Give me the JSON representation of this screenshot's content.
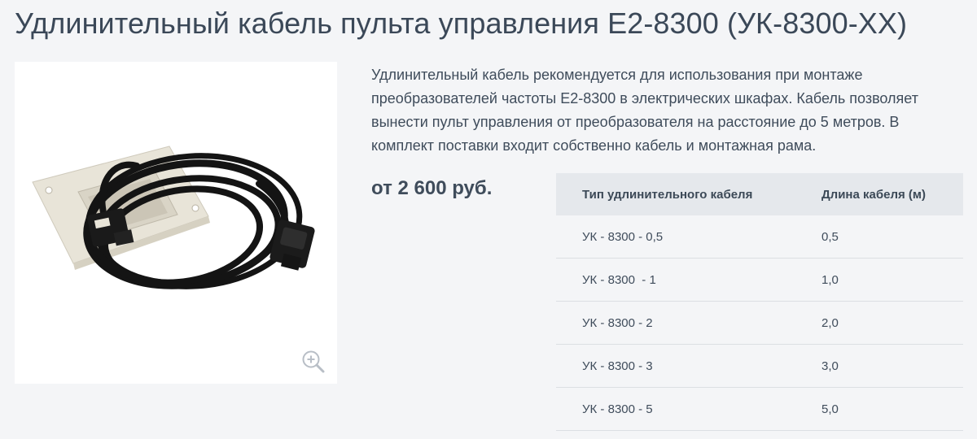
{
  "page": {
    "title": "Удлинительный кабель пульта управления Е2-8300 (УК-8300-ХХ)"
  },
  "product": {
    "image_alt": "Удлинительный кабель УК-8300 с монтажной рамой",
    "zoom_icon": "zoom-in-icon",
    "description": "Удлинительный кабель рекомендуется для использования при монтаже преобразователей частоты Е2-8300 в электрических шкафах. Кабель позволяет вынести пульт управления от преобразователя на расстояние до 5 метров. В комплект поставки входит собственно кабель и монтажная рама.",
    "price": "от 2 600 руб."
  },
  "table": {
    "headers": [
      "Тип удлинительного кабеля",
      "Длина кабеля (м)"
    ],
    "rows": [
      [
        "УК - 8300 - 0,5",
        "0,5"
      ],
      [
        "УК - 8300  - 1",
        "1,0"
      ],
      [
        "УК - 8300 - 2",
        "2,0"
      ],
      [
        "УК - 8300 - 3",
        "3,0"
      ],
      [
        "УК - 8300 - 5",
        "5,0"
      ]
    ]
  },
  "colors": {
    "background": "#f4f5f7",
    "text": "#3f4c5b",
    "table_header_bg": "#e5e8ec",
    "row_border": "#dcdfe3"
  }
}
